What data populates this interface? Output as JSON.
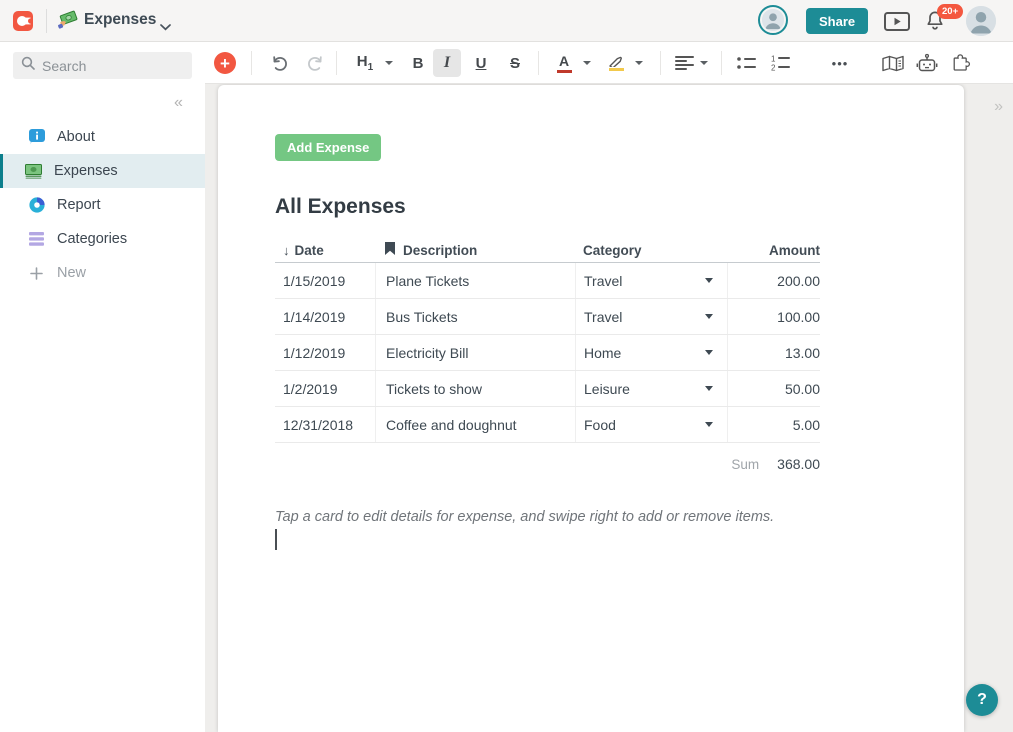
{
  "colors": {
    "brand_red": "#f25741",
    "teal": "#1d8c96",
    "button_green": "#74c783",
    "badge_red": "#f4573f",
    "selected_item_bg": "#e2edf0",
    "selected_item_border": "#0c7f8c"
  },
  "topbar": {
    "doc_title": "Expenses",
    "share_label": "Share",
    "notification_count": "20+"
  },
  "toolbar": {
    "h1": "H",
    "h1_sub": "1",
    "bold": "B",
    "italic": "I",
    "underline": "U",
    "strike": "S",
    "color_letter": "A",
    "more": "•••"
  },
  "sidebar": {
    "search_placeholder": "Search",
    "collapse_glyph": "«",
    "items": [
      {
        "label": "About"
      },
      {
        "label": "Expenses"
      },
      {
        "label": "Report"
      },
      {
        "label": "Categories"
      },
      {
        "label": "New"
      }
    ]
  },
  "page": {
    "expand_glyph": "»",
    "add_expense_label": "Add Expense",
    "heading": "All Expenses",
    "table": {
      "sort_glyph": "↓",
      "columns": [
        "Date",
        "Description",
        "Category",
        "Amount"
      ],
      "rows": [
        {
          "date": "1/15/2019",
          "description": "Plane Tickets",
          "category": "Travel",
          "amount": "200.00"
        },
        {
          "date": "1/14/2019",
          "description": "Bus Tickets",
          "category": "Travel",
          "amount": "100.00"
        },
        {
          "date": "1/12/2019",
          "description": "Electricity Bill",
          "category": "Home",
          "amount": "13.00"
        },
        {
          "date": "1/2/2019",
          "description": "Tickets to show",
          "category": "Leisure",
          "amount": "50.00"
        },
        {
          "date": "12/31/2018",
          "description": "Coffee and doughnut",
          "category": "Food",
          "amount": "5.00"
        }
      ],
      "sum_label": "Sum",
      "sum_value": "368.00"
    },
    "note": "Tap a card to edit details for expense, and swipe right to add or remove items.",
    "help_label": "?"
  }
}
